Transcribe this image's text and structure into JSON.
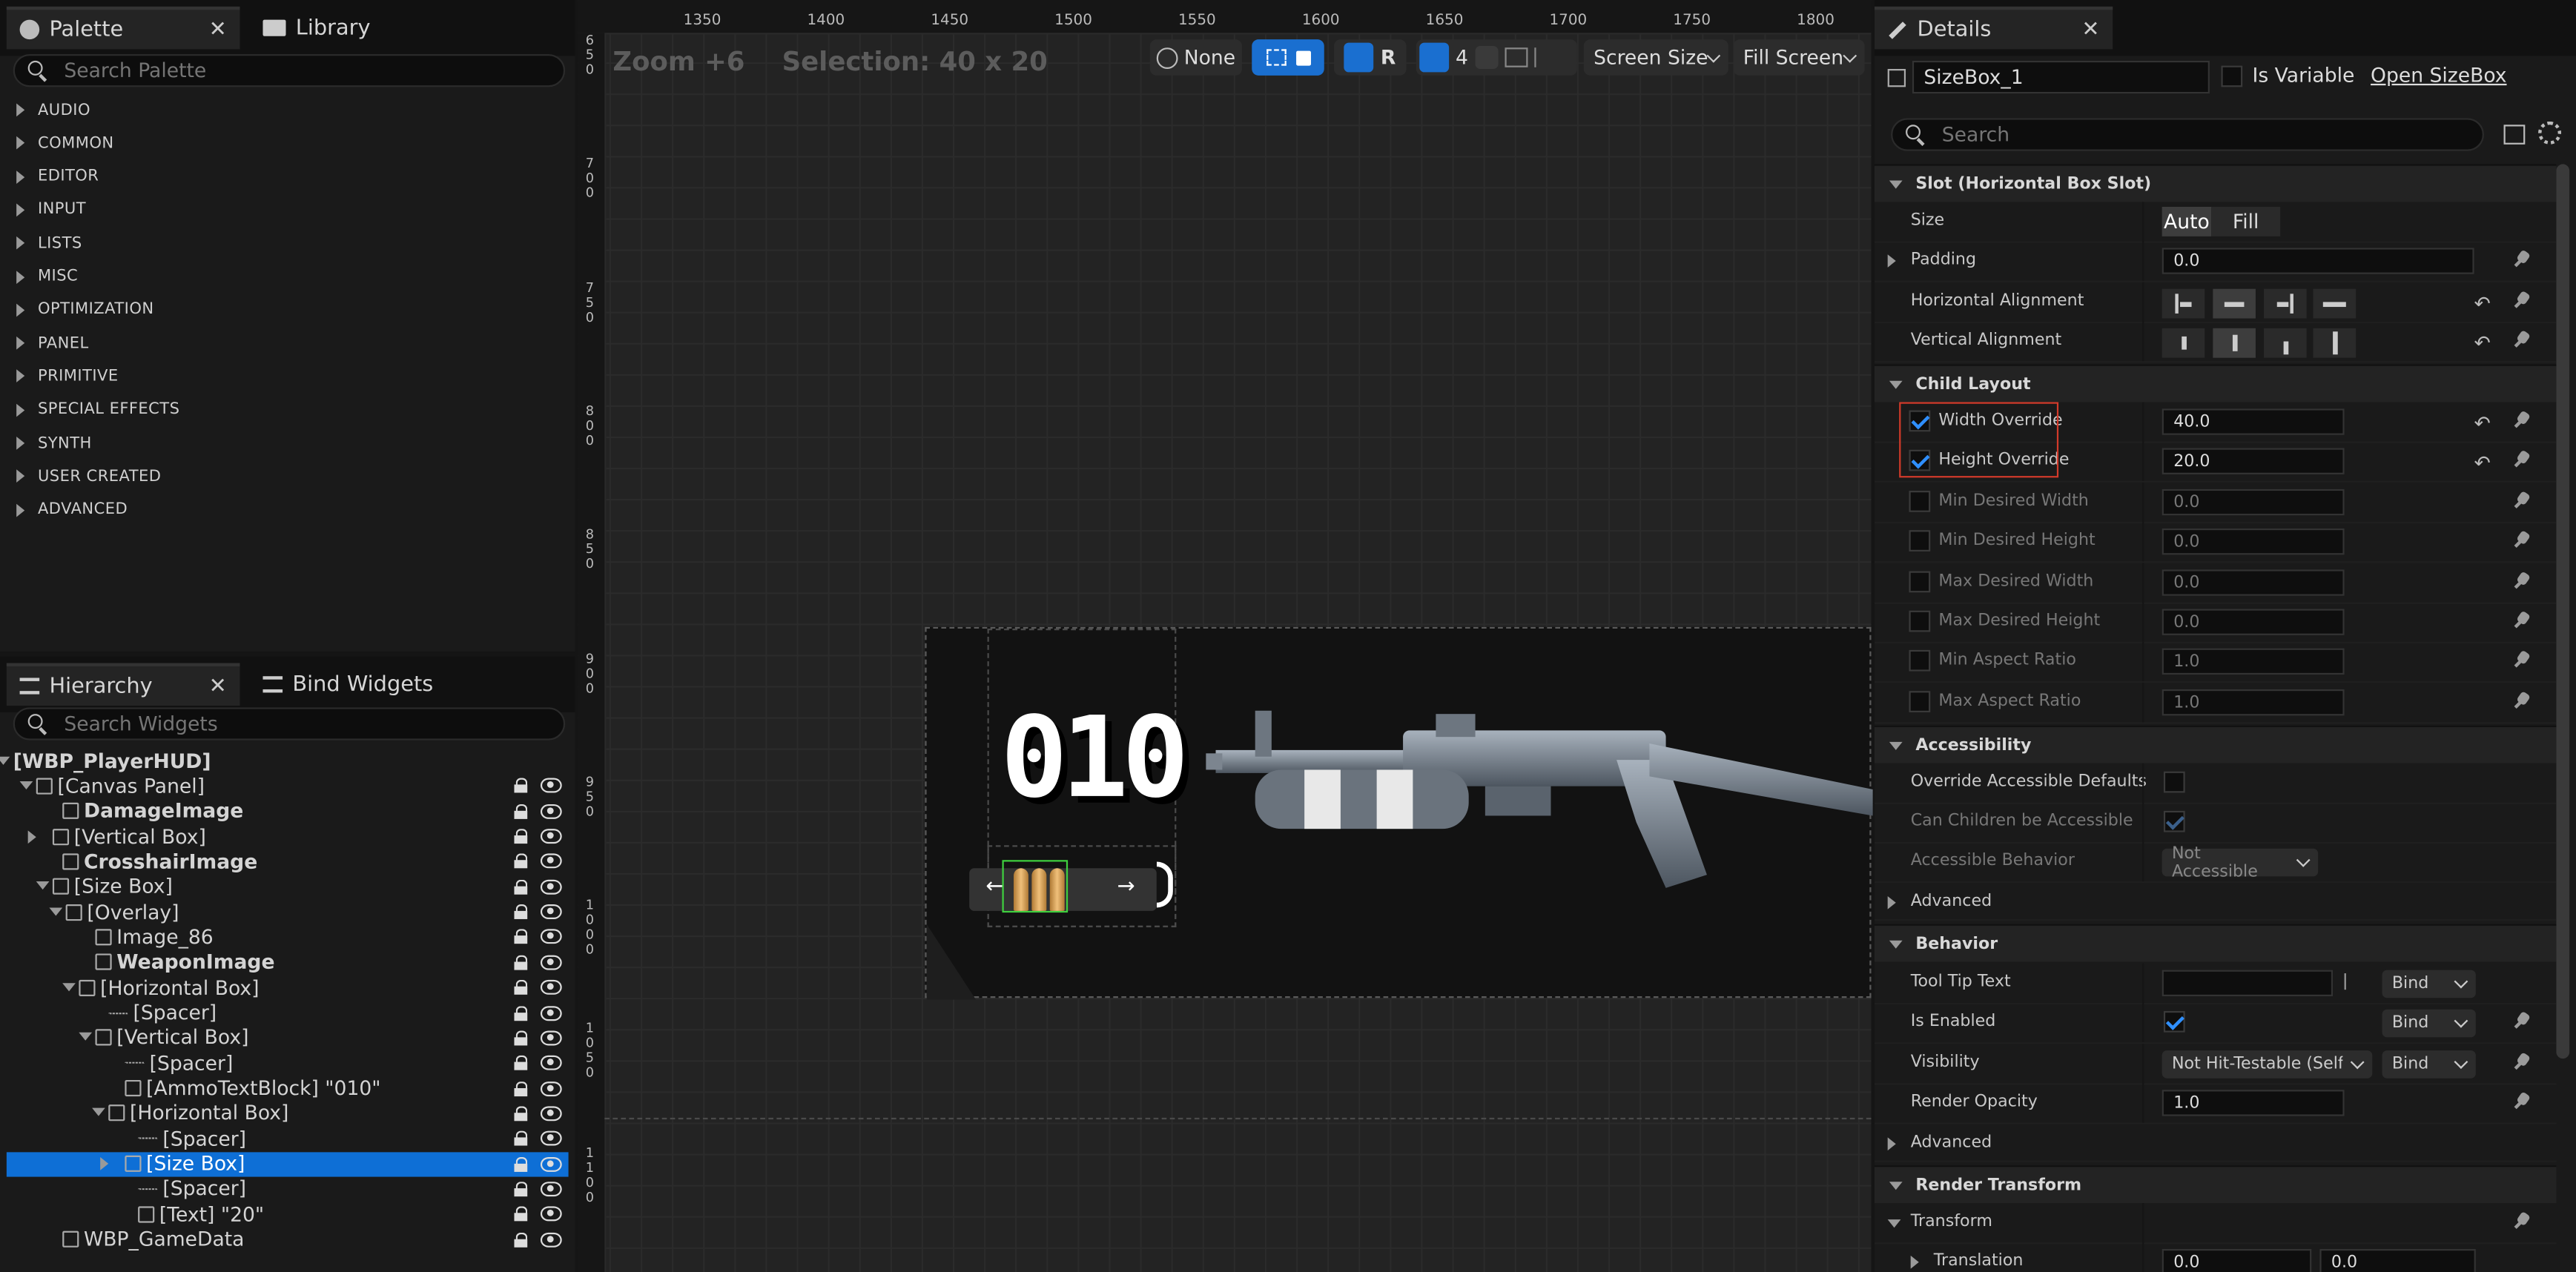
{
  "palette": {
    "tab_label": "Palette",
    "library_label": "Library",
    "search_placeholder": "Search Palette",
    "categories": [
      "AUDIO",
      "COMMON",
      "EDITOR",
      "INPUT",
      "LISTS",
      "MISC",
      "OPTIMIZATION",
      "PANEL",
      "PRIMITIVE",
      "SPECIAL EFFECTS",
      "SYNTH",
      "USER CREATED",
      "ADVANCED"
    ]
  },
  "hierarchy": {
    "tab_label": "Hierarchy",
    "bind_label": "Bind Widgets",
    "search_placeholder": "Search Widgets",
    "rows": [
      {
        "label": "[WBP_PlayerHUD]"
      },
      {
        "label": "[Canvas Panel]"
      },
      {
        "label": "DamageImage"
      },
      {
        "label": "[Vertical Box]"
      },
      {
        "label": "CrosshairImage"
      },
      {
        "label": "[Size Box]"
      },
      {
        "label": "[Overlay]"
      },
      {
        "label": "Image_86"
      },
      {
        "label": "WeaponImage"
      },
      {
        "label": "[Horizontal Box]"
      },
      {
        "label": "[Spacer]"
      },
      {
        "label": "[Vertical Box]"
      },
      {
        "label": "[Spacer]"
      },
      {
        "label": "[AmmoTextBlock] \"010\""
      },
      {
        "label": "[Horizontal Box]"
      },
      {
        "label": "[Spacer]"
      },
      {
        "label": "[Size Box]"
      },
      {
        "label": "[Spacer]"
      },
      {
        "label": "[Text] \"20\""
      },
      {
        "label": "WBP_GameData"
      }
    ]
  },
  "viewport": {
    "zoom": "Zoom +6",
    "selection": "Selection: 40 x 20",
    "ruler_top": [
      "1350",
      "1400",
      "1450",
      "1500",
      "1550",
      "1600",
      "1650",
      "1700",
      "1750",
      "1800"
    ],
    "ruler_left": [
      "650",
      "700",
      "750",
      "800",
      "850",
      "900",
      "950",
      "1000",
      "1050",
      "1100"
    ],
    "toolbar": {
      "none_label": "None",
      "r_label": "R",
      "grid_value": "4",
      "screen_size": "Screen Size",
      "fill_screen": "Fill Screen"
    },
    "hud": {
      "ammo_text": "010",
      "arrow_left": "←",
      "arrow_right": "→"
    }
  },
  "details": {
    "tab_label": "Details",
    "widget_name": "SizeBox_1",
    "is_variable_label": "Is Variable",
    "open_link": "Open SizeBox",
    "search_placeholder": "Search",
    "sections": {
      "slot": "Slot (Horizontal Box Slot)",
      "child_layout": "Child Layout",
      "accessibility": "Accessibility",
      "advanced1": "Advanced",
      "behavior": "Behavior",
      "advanced2": "Advanced",
      "render_transform": "Render Transform",
      "transform": "Transform"
    },
    "slot": {
      "size_label": "Size",
      "auto": "Auto",
      "fill": "Fill",
      "padding_label": "Padding",
      "padding_value": "0.0",
      "halign_label": "Horizontal Alignment",
      "valign_label": "Vertical Alignment"
    },
    "child_layout": {
      "width_override": "Width Override",
      "width_value": "40.0",
      "height_override": "Height Override",
      "height_value": "20.0",
      "min_w": "Min Desired Width",
      "min_w_v": "0.0",
      "min_h": "Min Desired Height",
      "min_h_v": "0.0",
      "max_w": "Max Desired Width",
      "max_w_v": "0.0",
      "max_h": "Max Desired Height",
      "max_h_v": "0.0",
      "min_ar": "Min Aspect Ratio",
      "min_ar_v": "1.0",
      "max_ar": "Max Aspect Ratio",
      "max_ar_v": "1.0"
    },
    "accessibility": {
      "override": "Override Accessible Defaults",
      "children": "Can Children be Accessible",
      "behavior": "Accessible Behavior",
      "behavior_value": "Not Accessible"
    },
    "behavior": {
      "tooltip": "Tool Tip Text",
      "bind": "Bind",
      "enabled": "Is Enabled",
      "visibility": "Visibility",
      "visibility_value": "Not Hit-Testable (Self O",
      "opacity": "Render Opacity",
      "opacity_value": "1.0"
    },
    "transform": {
      "translation": "Translation",
      "tx": "0.0",
      "ty": "0.0"
    }
  },
  "colors": {
    "accent": "#0e6fd6",
    "highlight_box": "#d23a2a",
    "selection_green": "#3fd03f"
  }
}
